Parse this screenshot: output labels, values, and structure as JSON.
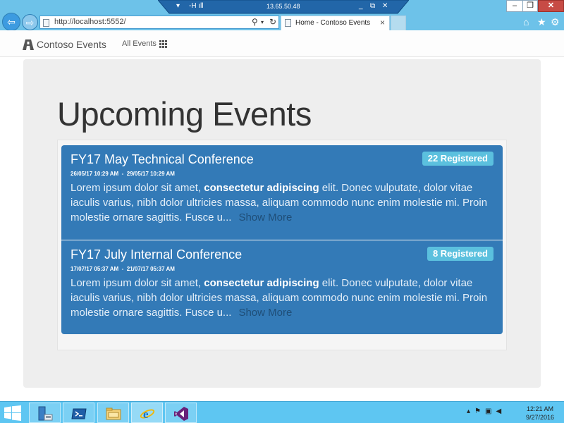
{
  "browser": {
    "url": "http://localhost:5552/",
    "tab_title": "Home - Contoso Events",
    "remote_host": "13.65.50.48"
  },
  "site": {
    "brand": "Contoso Events",
    "nav_all_events": "All Events"
  },
  "main": {
    "heading": "Upcoming Events",
    "events": [
      {
        "title": "FY17 May Technical Conference",
        "registered": "22 Registered",
        "dates": "26/05/17 10:29 AM  -  29/05/17 10:29 AM",
        "desc_start": "Lorem ipsum dolor sit amet,",
        "desc_bold": "consectetur adipiscing",
        "desc_end": "elit. Donec vulputate, dolor vitae iaculis varius, nibh dolor ultricies massa, aliquam commodo nunc enim molestie mi. Proin molestie ornare sagittis. Fusce u...",
        "show_more": "Show More"
      },
      {
        "title": "FY17 July Internal Conference",
        "registered": "8 Registered",
        "dates": "17/07/17 05:37 AM  -  21/07/17 05:37 AM",
        "desc_start": "Lorem ipsum dolor sit amet,",
        "desc_bold": "consectetur adipiscing",
        "desc_end": "elit. Donec vulputate, dolor vitae iaculis varius, nibh dolor ultricies massa, aliquam commodo nunc enim molestie mi. Proin molestie ornare sagittis. Fusce u...",
        "show_more": "Show More"
      }
    ]
  },
  "taskbar": {
    "time": "12:21 AM",
    "date": "9/27/2016"
  },
  "colors": {
    "card": "#337ab7",
    "badge": "#5bc0de",
    "jumbotron": "#eeeeee",
    "chrome": "#6dc2e9",
    "taskbar": "#5ec6f2"
  },
  "icons": [
    "back-arrow-icon",
    "forward-arrow-icon",
    "page-icon",
    "search-icon",
    "refresh-icon",
    "home-icon",
    "star-icon",
    "gear-icon",
    "grid-icon",
    "windows-logo-icon",
    "server-manager-icon",
    "powershell-icon",
    "file-explorer-icon",
    "internet-explorer-icon",
    "visual-studio-icon",
    "flag-icon",
    "network-icon",
    "volume-icon"
  ]
}
